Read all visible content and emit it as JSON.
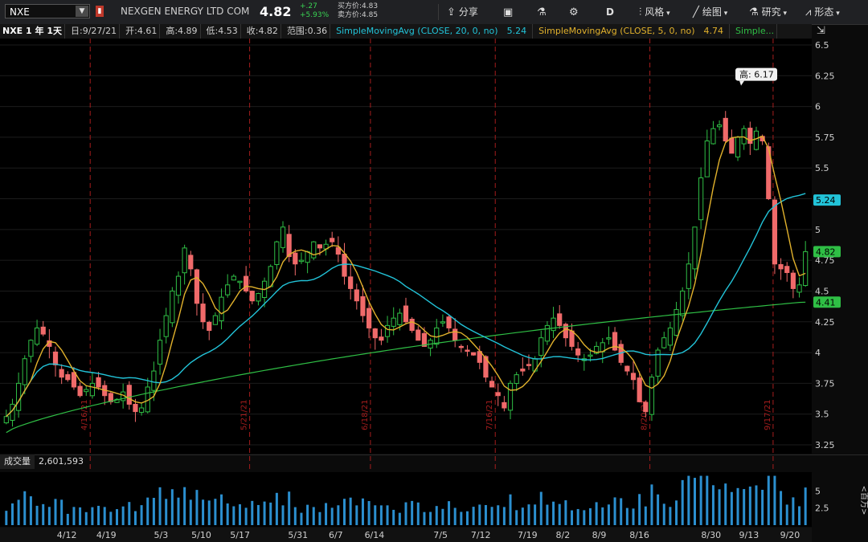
{
  "header": {
    "ticker": "NXE",
    "company": "NEXGEN ENERGY LTD COM",
    "last": "4.82",
    "change": "+.27",
    "change_pct": "+5.93%",
    "bid": "买方价:4.83",
    "ask": "卖方价:4.85"
  },
  "toolbar": {
    "share": "分享",
    "period": "D",
    "style": "风格",
    "draw": "绘图",
    "study": "研究",
    "pattern": "形态"
  },
  "infobar": {
    "symbol": "NXE 1 年 1天",
    "date": "日:9/27/21",
    "open": "开:4.61",
    "high": "高:4.89",
    "low": "低:4.53",
    "close": "收:4.82",
    "range": "范围:0.36",
    "sma20_label": "SimpleMovingAvg (CLOSE, 20, 0, no)",
    "sma20_val": "5.24",
    "sma5_label": "SimpleMovingAvg (CLOSE, 5, 0, no)",
    "sma5_val": "4.74",
    "sma_more": "Simple..."
  },
  "price_axis": {
    "ticks": [
      "6.5",
      "6.25",
      "6",
      "5.75",
      "5.5",
      "5.25",
      "5",
      "4.75",
      "4.5",
      "4.25",
      "4",
      "3.75",
      "3.5",
      "3.25"
    ],
    "tick_values": [
      6.5,
      6.25,
      6,
      5.75,
      5.5,
      5.25,
      5,
      4.75,
      4.5,
      4.25,
      4,
      3.75,
      3.5,
      3.25
    ],
    "min": 3.25,
    "max": 6.5,
    "badge_sma20": "5.24",
    "badge_last": "4.82",
    "badge_sma_long": "4.41",
    "high_callout": "高: 6.17"
  },
  "date_axis": [
    "4/12",
    "4/19",
    "5/3",
    "5/10",
    "5/17",
    "5/31",
    "6/7",
    "6/14",
    "7/5",
    "7/12",
    "7/19",
    "8/2",
    "8/9",
    "8/16",
    "8/30",
    "9/13",
    "9/20"
  ],
  "expiry_labels": [
    "4/16/21",
    "5/21/21",
    "6/18/21",
    "7/16/21",
    "8/20/21",
    "9/17/21"
  ],
  "volume": {
    "label": "成交量",
    "value": "2,601,593",
    "unit": "<百万>",
    "ticks": [
      "5",
      "2.5"
    ]
  },
  "colors": {
    "up": "#2fbf45",
    "down": "#f06a6a",
    "sma20": "#22c3d8",
    "sma5": "#e1b12c",
    "sma_long": "#2fbf45",
    "volume": "#2b8fcf",
    "expiry": "#a51d1d"
  },
  "chart_data": {
    "type": "candlestick",
    "closes": [
      3.48,
      3.58,
      3.75,
      3.95,
      4.1,
      4.2,
      4.15,
      4.05,
      3.9,
      3.8,
      3.78,
      3.72,
      3.65,
      3.7,
      3.75,
      3.72,
      3.65,
      3.6,
      3.62,
      3.68,
      3.58,
      3.52,
      3.55,
      3.72,
      3.85,
      4.1,
      4.3,
      4.5,
      4.62,
      4.85,
      4.68,
      4.4,
      4.25,
      4.18,
      4.3,
      4.45,
      4.55,
      4.62,
      4.58,
      4.5,
      4.42,
      4.48,
      4.58,
      4.7,
      4.9,
      5.02,
      4.78,
      4.72,
      4.75,
      4.82,
      4.9,
      4.85,
      4.88,
      4.9,
      4.8,
      4.62,
      4.52,
      4.42,
      4.3,
      4.2,
      4.12,
      4.1,
      4.22,
      4.28,
      4.32,
      4.25,
      4.18,
      4.1,
      4.05,
      4.1,
      4.2,
      4.25,
      4.2,
      4.1,
      4.05,
      4.02,
      3.98,
      3.92,
      3.8,
      3.72,
      3.65,
      3.55,
      3.75,
      3.82,
      3.85,
      3.9,
      3.95,
      4.12,
      4.22,
      4.28,
      4.22,
      4.12,
      4.05,
      3.98,
      3.95,
      3.98,
      4.05,
      4.08,
      4.12,
      4.02,
      3.92,
      3.85,
      3.78,
      3.6,
      3.52,
      3.8,
      4.02,
      4.12,
      4.2,
      4.35,
      4.5,
      4.72,
      5.02,
      5.42,
      5.72,
      5.82,
      5.85,
      5.72,
      5.62,
      5.75,
      5.82,
      5.7,
      5.8,
      5.72,
      5.25,
      4.72,
      4.68,
      4.65,
      4.52,
      4.55,
      4.82
    ],
    "sma_long_last": 4.41,
    "sma20_last": 5.24,
    "sma5_last": 4.74,
    "high_marker": 6.17,
    "volume_ticks": [
      5,
      2.5
    ],
    "volume_unit": "<百万>"
  }
}
